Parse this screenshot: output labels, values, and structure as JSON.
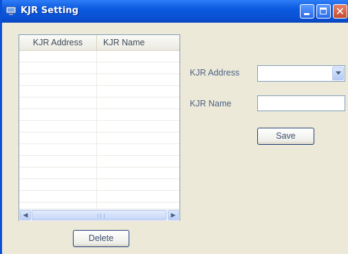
{
  "window": {
    "title": "KJR Setting",
    "accent_color": "#0A50D2",
    "icon": "computer-window-icon",
    "controls": [
      "minimize-icon",
      "maximize-icon",
      "close-icon"
    ]
  },
  "list": {
    "columns": [
      "KJR Address",
      "KJR Name"
    ],
    "rows": []
  },
  "form": {
    "address_label": "KJR Address",
    "address_value": "",
    "name_label": "KJR Name",
    "name_value": "",
    "save_label": "Save"
  },
  "delete_label": "Delete"
}
